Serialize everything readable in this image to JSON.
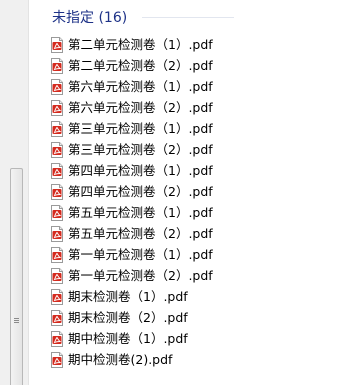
{
  "group": {
    "title": "未指定 (16)"
  },
  "files": [
    {
      "name": "第二单元检测卷（1）.pdf",
      "icon": "pdf-file-icon"
    },
    {
      "name": "第二单元检测卷（2）.pdf",
      "icon": "pdf-file-icon"
    },
    {
      "name": "第六单元检测卷（1）.pdf",
      "icon": "pdf-file-icon"
    },
    {
      "name": "第六单元检测卷（2）.pdf",
      "icon": "pdf-file-icon"
    },
    {
      "name": "第三单元检测卷（1）.pdf",
      "icon": "pdf-file-icon"
    },
    {
      "name": "第三单元检测卷（2）.pdf",
      "icon": "pdf-file-icon"
    },
    {
      "name": "第四单元检测卷（1）.pdf",
      "icon": "pdf-file-icon"
    },
    {
      "name": "第四单元检测卷（2）.pdf",
      "icon": "pdf-file-icon"
    },
    {
      "name": "第五单元检测卷（1）.pdf",
      "icon": "pdf-file-icon"
    },
    {
      "name": "第五单元检测卷（2）.pdf",
      "icon": "pdf-file-icon"
    },
    {
      "name": "第一单元检测卷（1）.pdf",
      "icon": "pdf-file-icon"
    },
    {
      "name": "第一单元检测卷（2）.pdf",
      "icon": "pdf-file-icon"
    },
    {
      "name": "期末检测卷（1）.pdf",
      "icon": "pdf-file-icon"
    },
    {
      "name": "期末检测卷（2）.pdf",
      "icon": "pdf-file-icon"
    },
    {
      "name": "期中检测卷（1）.pdf",
      "icon": "pdf-file-icon"
    },
    {
      "name": "期中检测卷(2).pdf",
      "icon": "pdf-file-icon"
    }
  ],
  "colors": {
    "group_title": "#1e3287",
    "pdf_red": "#d42a1e",
    "scrollbar_track": "#f0f0f0"
  }
}
